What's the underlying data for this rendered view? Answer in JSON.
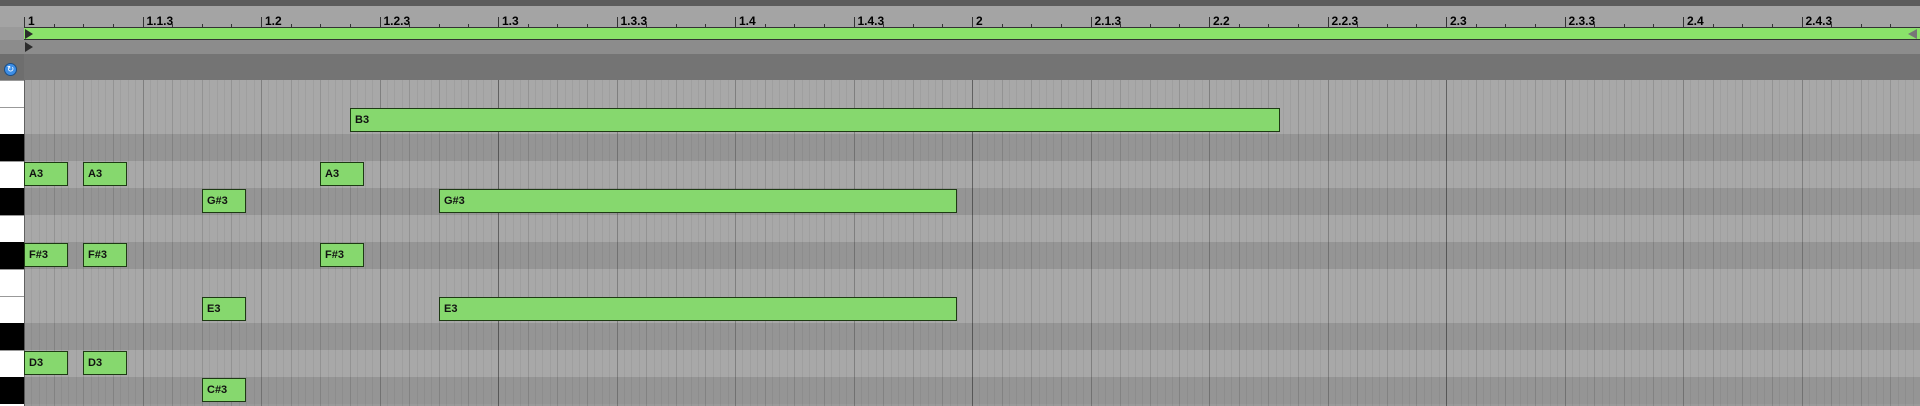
{
  "ruler": {
    "labels": [
      "1",
      "1.1.3",
      "1.2",
      "1.2.3",
      "1.3",
      "1.3.3",
      "1.4",
      "1.4.3",
      "2",
      "2.1.3",
      "2.2",
      "2.2.3",
      "2.3",
      "2.3.3",
      "2.4",
      "2.4.3"
    ]
  },
  "piano": {
    "rows": [
      "C4",
      "B3",
      "A#3",
      "A3",
      "G#3",
      "G3",
      "F#3",
      "F3",
      "E3",
      "D#3",
      "D3",
      "C#3"
    ],
    "black_keys": [
      "A#3",
      "G#3",
      "F#3",
      "D#3",
      "C#3"
    ]
  },
  "notes": [
    {
      "pitch": "B3",
      "label": "B3",
      "start": 2.75,
      "end": 10.6
    },
    {
      "pitch": "A3",
      "label": "A3",
      "start": 0.0,
      "end": 0.375
    },
    {
      "pitch": "A3",
      "label": "A3",
      "start": 0.5,
      "end": 0.875
    },
    {
      "pitch": "A3",
      "label": "A3",
      "start": 2.5,
      "end": 2.875
    },
    {
      "pitch": "G#3",
      "label": "G#3",
      "start": 1.5,
      "end": 1.875
    },
    {
      "pitch": "G#3",
      "label": "G#3",
      "start": 3.5,
      "end": 7.875
    },
    {
      "pitch": "F#3",
      "label": "F#3",
      "start": 0.0,
      "end": 0.375
    },
    {
      "pitch": "F#3",
      "label": "F#3",
      "start": 0.5,
      "end": 0.875
    },
    {
      "pitch": "F#3",
      "label": "F#3",
      "start": 2.5,
      "end": 2.875
    },
    {
      "pitch": "E3",
      "label": "E3",
      "start": 1.5,
      "end": 1.875
    },
    {
      "pitch": "E3",
      "label": "E3",
      "start": 3.5,
      "end": 7.875
    },
    {
      "pitch": "D3",
      "label": "D3",
      "start": 0.0,
      "end": 0.375
    },
    {
      "pitch": "D3",
      "label": "D3",
      "start": 0.5,
      "end": 0.875
    },
    {
      "pitch": "C#3",
      "label": "C#3",
      "start": 1.5,
      "end": 1.875
    }
  ],
  "colors": {
    "note_fill": "#86d86e",
    "loop_bar": "#8ae26a",
    "fold_button": "#3d8ee6"
  },
  "icons": {
    "fold_button": "fold-icon",
    "start_marker": "start-marker-icon",
    "loop_end": "loop-end-icon"
  }
}
